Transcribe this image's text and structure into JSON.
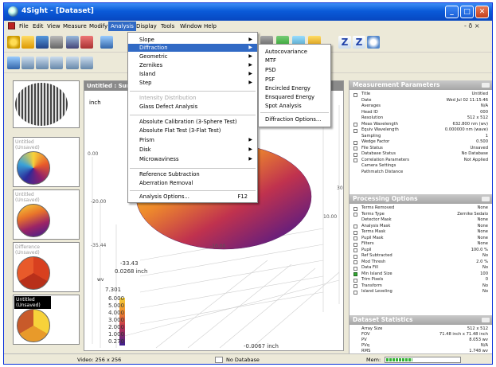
{
  "window": {
    "title": "4Sight - [Dataset]",
    "controls": {
      "minimize": "_",
      "maximize": "□",
      "close": "✕",
      "mdi": "- ð ×"
    }
  },
  "menubar": {
    "items": [
      "File",
      "Edit",
      "View",
      "Measure",
      "Modify",
      "Analysis",
      "Display",
      "Tools",
      "Window",
      "Help"
    ],
    "active": "Analysis"
  },
  "analysis_menu": {
    "items": [
      {
        "label": "Slope",
        "submenu": true
      },
      {
        "label": "Diffraction",
        "submenu": true,
        "highlighted": true
      },
      {
        "label": "Geometric",
        "submenu": true
      },
      {
        "label": "Zernikes",
        "submenu": true
      },
      {
        "label": "Island",
        "submenu": true
      },
      {
        "label": "Step",
        "submenu": true
      },
      {
        "label": "Intensity Distribution",
        "disabled": true
      },
      {
        "label": "Glass Defect Analysis"
      },
      {
        "label": "Absolute Calibration (3-Sphere Test)"
      },
      {
        "label": "Absolute Flat Test (3-Flat Test)"
      },
      {
        "label": "Prism",
        "submenu": true
      },
      {
        "label": "Disk",
        "submenu": true
      },
      {
        "label": "Microwaviness",
        "submenu": true
      },
      {
        "label": "Reference Subtraction"
      },
      {
        "label": "Aberration Removal"
      },
      {
        "label": "Analysis Options...",
        "shortcut": "F12"
      }
    ]
  },
  "diffraction_menu": {
    "items": [
      "Autocovariance",
      "MTF",
      "PSD",
      "PSF",
      "Encircled Energy",
      "Ensquared Energy",
      "Spot Analysis",
      "Diffraction Options..."
    ]
  },
  "thumbnails": [
    {
      "title": "Untitled",
      "state": "(Unsaved)",
      "selected": false
    },
    {
      "title": "Untitled",
      "state": "(Unsaved)",
      "selected": false
    },
    {
      "title": "Difference",
      "state": "(Unsaved)",
      "selected": false
    },
    {
      "title": "Untitled",
      "state": "(Unsaved)",
      "selected": true
    }
  ],
  "view": {
    "title": "Untitled : Surf",
    "unit_label": "inch",
    "axis_labels": [
      "0.00",
      "-20.00",
      "-35.44",
      "-10.00",
      "10.00",
      "30",
      "-33.43",
      "0.0268 inch",
      "-0.0067 inch"
    ],
    "legend_unit": "wv",
    "legend_values": [
      "7.301",
      "6.000",
      "5.000",
      "4.000",
      "3.000",
      "2.000",
      "1.000",
      "0.270"
    ]
  },
  "measurement_parameters": {
    "title": "Measurement Parameters",
    "rows": [
      {
        "label": "Title",
        "value": "Untitled",
        "check": true
      },
      {
        "label": "Date",
        "value": "Wed Jul 02 11:15:46",
        "check": false
      },
      {
        "label": "Averages",
        "value": "N/A",
        "check": false
      },
      {
        "label": "Head ID",
        "value": "000",
        "check": false
      },
      {
        "label": "Resolution",
        "value": "512 x 512",
        "check": false
      },
      {
        "label": "Meas Wavelength",
        "value": "632.800 nm (wv)",
        "check": true
      },
      {
        "label": "Equiv Wavelength",
        "value": "0.000000 nm (wave)",
        "check": true
      },
      {
        "label": "Sampling",
        "value": "1",
        "check": false
      },
      {
        "label": "Wedge Factor",
        "value": "0.500",
        "check": true
      },
      {
        "label": "File Status",
        "value": "Unsaved",
        "check": true
      },
      {
        "label": "Database Status",
        "value": "No Database",
        "check": true
      },
      {
        "label": "Correlation Parameters",
        "value": "Not Applied",
        "check": true
      },
      {
        "label": "Camera Settings",
        "value": "",
        "check": false
      },
      {
        "label": "Pathmatch Distance",
        "value": "",
        "check": false
      }
    ]
  },
  "processing_options": {
    "title": "Processing Options",
    "rows": [
      {
        "label": "Terms Removed",
        "value": "None",
        "check": true
      },
      {
        "label": "Terms Type",
        "value": "Zernike Sedalo",
        "check": true
      },
      {
        "label": "Detector Mask",
        "value": "None",
        "check": false
      },
      {
        "label": "Analysis Mask",
        "value": "None",
        "check": true
      },
      {
        "label": "Terms Mask",
        "value": "None",
        "check": true
      },
      {
        "label": "Pupil Mask",
        "value": "None",
        "check": true
      },
      {
        "label": "Filters",
        "value": "None",
        "check": true
      },
      {
        "label": "Pupil",
        "value": "100.0 %",
        "check": true
      },
      {
        "label": "Ref Subtracted",
        "value": "No",
        "check": true
      },
      {
        "label": "Mod Thresh",
        "value": "2.0 %",
        "check": true
      },
      {
        "label": "Data Fill",
        "value": "No",
        "check": true
      },
      {
        "label": "Min Island Size",
        "value": "100",
        "check": true,
        "on": true
      },
      {
        "label": "Trim Pixels",
        "value": "0",
        "check": true
      },
      {
        "label": "Transform",
        "value": "No",
        "check": true
      },
      {
        "label": "Island Leveling",
        "value": "No",
        "check": true
      }
    ]
  },
  "dataset_statistics": {
    "title": "Dataset Statistics",
    "rows": [
      {
        "label": "Array Size",
        "value": "512 x 512"
      },
      {
        "label": "FOV",
        "value": "71.48 inch x 71.48 inch"
      },
      {
        "label": "PV",
        "value": "8.053 wv"
      },
      {
        "label": "PVq",
        "value": "N/A"
      },
      {
        "label": "RMS",
        "value": "1.748 wv"
      }
    ]
  },
  "statusbar": {
    "video": "Video: 256 x 256",
    "database": "No Database",
    "memory_label": "Mem:",
    "memory_fraction": 0.35
  },
  "colors": {
    "titlebar": "#0a5ad8",
    "menu_highlight": "#316ac5",
    "surface_hot": "#f7d23a",
    "surface_cold": "#3b1f8f"
  }
}
